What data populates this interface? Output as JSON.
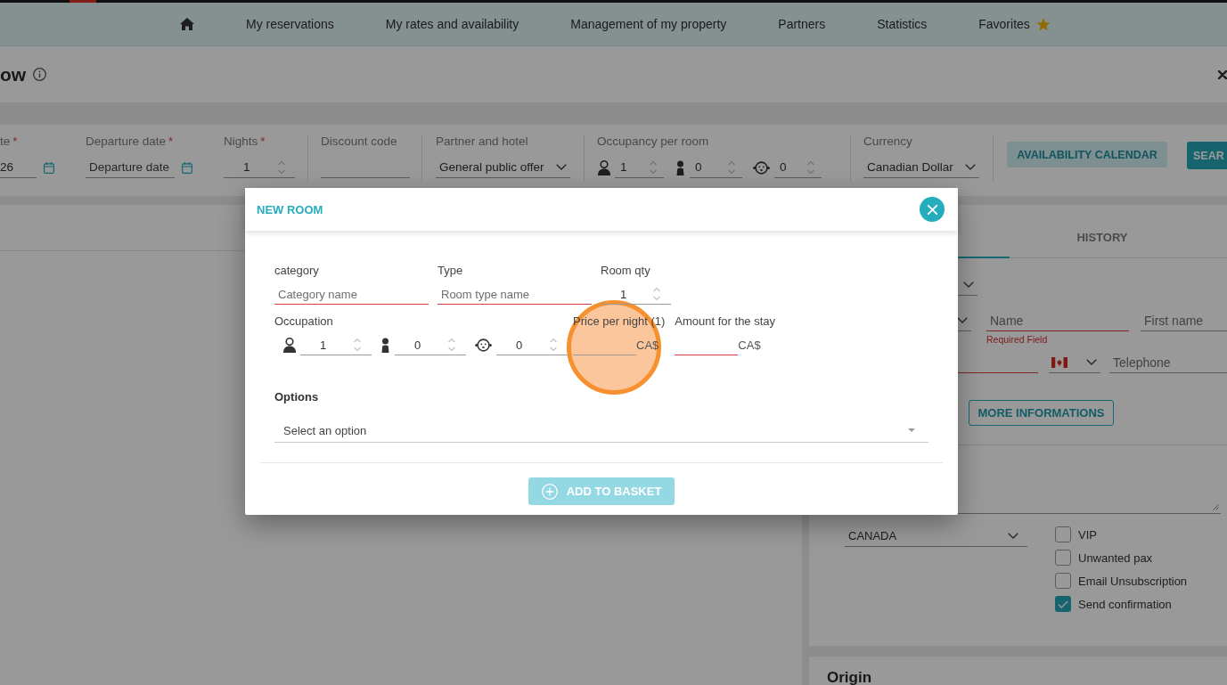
{
  "top_nav": {
    "items": [
      {
        "kind": "home"
      },
      {
        "kind": "link",
        "label": "My reservations"
      },
      {
        "kind": "link",
        "label": "My rates and availability"
      },
      {
        "kind": "link",
        "label": "Management of my property"
      },
      {
        "kind": "link",
        "label": "Partners"
      },
      {
        "kind": "link",
        "label": "Statistics"
      },
      {
        "kind": "favorites",
        "label": "Favorites"
      }
    ]
  },
  "page_header": {
    "title": "ow"
  },
  "search_bar": {
    "fields": [
      {
        "kind": "date",
        "label": "te",
        "required_mark": "*",
        "value": "26"
      },
      {
        "kind": "date",
        "label": "Departure date",
        "required_mark": "*",
        "placeholder": "Departure date"
      },
      {
        "kind": "number",
        "label": "Nights",
        "required_mark": "*",
        "value": "1"
      },
      {
        "kind": "text",
        "label": "Discount code"
      },
      {
        "kind": "select",
        "label": "Partner and hotel",
        "value": "General public offer"
      },
      {
        "kind": "occupancy",
        "label": "Occupancy per room",
        "counts": [
          {
            "kind": "adult",
            "value": "1"
          },
          {
            "kind": "child",
            "value": "0"
          },
          {
            "kind": "baby",
            "value": "0"
          }
        ]
      },
      {
        "kind": "select",
        "label": "Currency",
        "value": "Canadian Dollar"
      }
    ],
    "buttons": [
      {
        "kind": "secondary",
        "label": "AVAILABILITY CALENDAR"
      },
      {
        "kind": "primary",
        "label": "SEAR"
      }
    ]
  },
  "client_panel": {
    "tabs": [
      {
        "label": "HISTORY",
        "selected": false
      }
    ],
    "contact_rows": [
      [
        {
          "kind": "select",
          "invalid": false
        }
      ],
      [
        {
          "kind": "select",
          "invalid": false
        },
        {
          "kind": "text",
          "placeholder": "Name",
          "invalid": true,
          "error": "Required Field"
        },
        {
          "kind": "text",
          "placeholder": "First name",
          "invalid": false
        }
      ],
      [
        {
          "kind": "text",
          "invalid": true
        },
        {
          "kind": "phone_country",
          "invalid": false
        },
        {
          "kind": "text",
          "placeholder": "Telephone",
          "invalid": false
        }
      ]
    ],
    "more_button": {
      "label": "MORE INFORMATIONS"
    },
    "country_select": {
      "value": "CANADA"
    },
    "checkboxes": [
      {
        "label": "VIP",
        "checked": false
      },
      {
        "label": "Unwanted pax",
        "checked": false
      },
      {
        "label": "Email Unsubscription",
        "checked": false
      },
      {
        "label": "Send confirmation",
        "checked": true
      }
    ]
  },
  "origin_card": {
    "title": "Origin"
  },
  "modal": {
    "title": "NEW ROOM",
    "room_fields": [
      {
        "kind": "text",
        "label": "category",
        "placeholder": "Category name",
        "invalid": true
      },
      {
        "kind": "text",
        "label": "Type",
        "placeholder": "Room type name",
        "invalid": true
      },
      {
        "kind": "number",
        "label": "Room qty",
        "value": "1",
        "invalid": false
      }
    ],
    "occupation": {
      "label": "Occupation",
      "counts": [
        {
          "kind": "adult",
          "value": "1"
        },
        {
          "kind": "child",
          "value": "0"
        },
        {
          "kind": "baby",
          "value": "0"
        }
      ]
    },
    "amounts": [
      {
        "label": "Price per night (1)",
        "suffix": "CA$",
        "invalid": false
      },
      {
        "label": "Amount for the stay",
        "suffix": "CA$",
        "invalid": true
      }
    ],
    "options": {
      "label": "Options",
      "placeholder": "Select an option"
    },
    "add_button": {
      "label": "ADD TO BASKET",
      "disabled": true
    }
  }
}
